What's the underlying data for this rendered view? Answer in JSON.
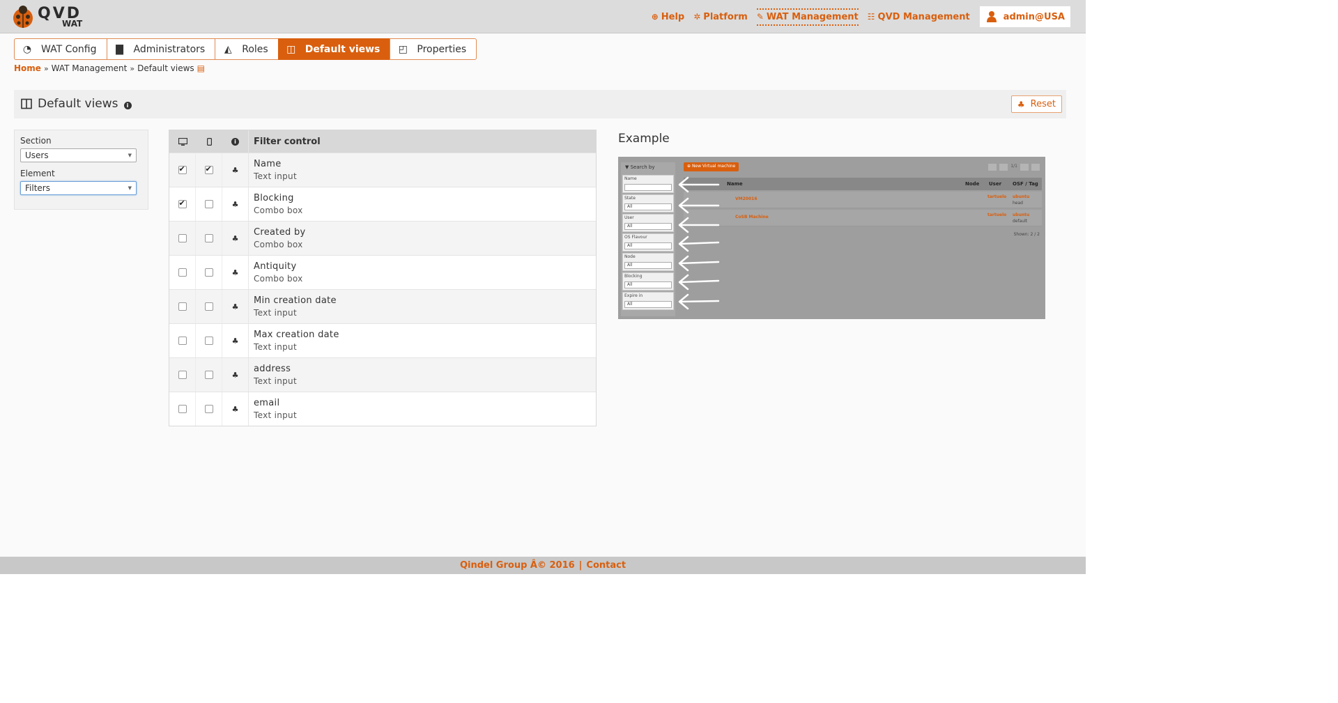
{
  "app": {
    "logo_text": "QVD",
    "logo_sub": "WAT"
  },
  "topnav": {
    "items": [
      {
        "label": "Help",
        "icon": "lifebuoy-icon"
      },
      {
        "label": "Platform",
        "icon": "cogs-icon"
      },
      {
        "label": "WAT Management",
        "icon": "wrench-icon",
        "active": true
      },
      {
        "label": "QVD Management",
        "icon": "sliders-icon"
      }
    ],
    "user": "admin@USA"
  },
  "tabs": [
    {
      "label": "WAT Config",
      "icon": "dashboard-icon"
    },
    {
      "label": "Administrators",
      "icon": "suitcase-icon"
    },
    {
      "label": "Roles",
      "icon": "graduation-cap-icon"
    },
    {
      "label": "Default views",
      "icon": "columns-icon",
      "active": true
    },
    {
      "label": "Properties",
      "icon": "sticky-note-icon"
    }
  ],
  "breadcrumb": {
    "home": "Home",
    "section": "WAT Management",
    "current": "Default views"
  },
  "section": {
    "title": "Default views",
    "reset_label": "Reset"
  },
  "filter_panel": {
    "section_label": "Section",
    "section_value": "Users",
    "element_label": "Element",
    "element_value": "Filters"
  },
  "table": {
    "header": "Filter control",
    "rows": [
      {
        "name": "Name",
        "type": "Text input",
        "desktop": true,
        "mobile": true
      },
      {
        "name": "Blocking",
        "type": "Combo box",
        "desktop": true,
        "mobile": false
      },
      {
        "name": "Created by",
        "type": "Combo box",
        "desktop": false,
        "mobile": false
      },
      {
        "name": "Antiquity",
        "type": "Combo box",
        "desktop": false,
        "mobile": false
      },
      {
        "name": "Min creation date",
        "type": "Text input",
        "desktop": false,
        "mobile": false
      },
      {
        "name": "Max creation date",
        "type": "Text input",
        "desktop": false,
        "mobile": false
      },
      {
        "name": "address",
        "type": "Text input",
        "desktop": false,
        "mobile": false
      },
      {
        "name": "email",
        "type": "Text input",
        "desktop": false,
        "mobile": false
      }
    ]
  },
  "example": {
    "title": "Example",
    "search_by": "Search by",
    "new_button": "New Virtual machine",
    "pager": "1/1",
    "fields": [
      "Name",
      "State",
      "User",
      "OS Flavour",
      "Node",
      "Blocking",
      "Expire in"
    ],
    "field_default": "All",
    "columns": [
      "Name",
      "Node",
      "User",
      "OSF / Tag"
    ],
    "rows": [
      {
        "name": "VM20016",
        "user": "tartuelo",
        "osf": "ubuntu",
        "tag": "head"
      },
      {
        "name": "CoSB Machine",
        "user": "tartuelo",
        "osf": "ubuntu",
        "tag": "default"
      }
    ],
    "shown": "Shown: 2 / 2"
  },
  "footer": {
    "company": "Qindel Group Â© 2016",
    "separator": "|",
    "contact": "Contact"
  },
  "colors": {
    "accent": "#d95f0e",
    "header_bg": "#dcdcdc"
  }
}
